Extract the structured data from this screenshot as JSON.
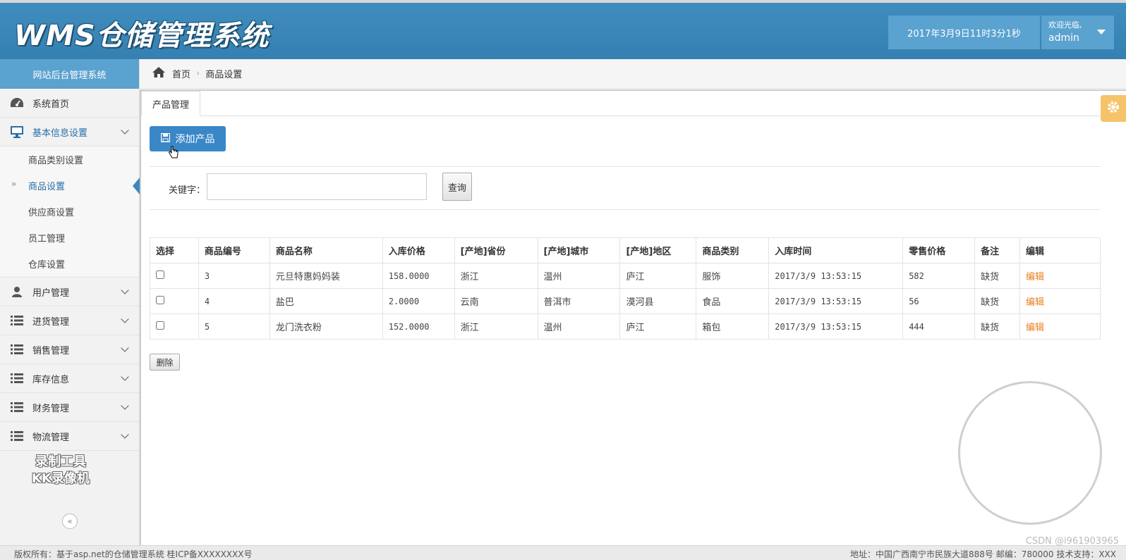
{
  "header": {
    "logo": "WMS仓储管理系统",
    "datetime": "2017年3月9日11时3分1秒",
    "welcome": "欢迎光临,",
    "username": "admin"
  },
  "sidebar": {
    "title": "网站后台管理系统",
    "items": [
      {
        "label": "系统首页",
        "icon": "dashboard-icon"
      },
      {
        "label": "基本信息设置",
        "icon": "monitor-icon"
      },
      {
        "label": "用户管理",
        "icon": "user-icon"
      },
      {
        "label": "进货管理",
        "icon": "list-icon"
      },
      {
        "label": "销售管理",
        "icon": "list-icon"
      },
      {
        "label": "库存信息",
        "icon": "list-icon"
      },
      {
        "label": "财务管理",
        "icon": "list-icon"
      },
      {
        "label": "物流管理",
        "icon": "list-icon"
      }
    ],
    "subitems": [
      "商品类别设置",
      "商品设置",
      "供应商设置",
      "员工管理",
      "仓库设置"
    ],
    "watermark_line1": "录制工具",
    "watermark_line2": "KK录像机"
  },
  "breadcrumb": {
    "home": "首页",
    "current": "商品设置"
  },
  "tab": {
    "label": "产品管理"
  },
  "toolbar": {
    "add_label": "添加产品"
  },
  "search": {
    "label": "关键字：",
    "value": "",
    "button": "查询"
  },
  "table": {
    "headers": [
      "选择",
      "商品编号",
      "商品名称",
      "入库价格",
      "[产地]省份",
      "[产地]城市",
      "[产地]地区",
      "商品类别",
      "入库时间",
      "零售价格",
      "备注",
      "编辑"
    ],
    "rows": [
      {
        "id": "3",
        "name": "元旦特惠妈妈装",
        "price": "158.0000",
        "province": "浙江",
        "city": "温州",
        "district": "庐江",
        "category": "服饰",
        "time": "2017/3/9 13:53:15",
        "retail": "582",
        "note": "缺货",
        "edit": "编辑"
      },
      {
        "id": "4",
        "name": "盐巴",
        "price": "2.0000",
        "province": "云南",
        "city": "普洱市",
        "district": "漠河县",
        "category": "食品",
        "time": "2017/3/9 13:53:15",
        "retail": "56",
        "note": "缺货",
        "edit": "编辑"
      },
      {
        "id": "5",
        "name": "龙门洗衣粉",
        "price": "152.0000",
        "province": "浙江",
        "city": "温州",
        "district": "庐江",
        "category": "箱包",
        "time": "2017/3/9 13:53:15",
        "retail": "444",
        "note": "缺货",
        "edit": "编辑"
      }
    ]
  },
  "delete_label": "删除",
  "footer": {
    "left": "版权所有：基于asp.net的仓储管理系统 桂ICP备XXXXXXXX号",
    "right": "地址：中国广西南宁市民族大道888号 邮编：780000 技术支持：XXX",
    "csdn": "CSDN @i961903965"
  },
  "colors": {
    "primary": "#3a87c7",
    "header": "#3f8dbe",
    "link": "#e87e1c"
  }
}
